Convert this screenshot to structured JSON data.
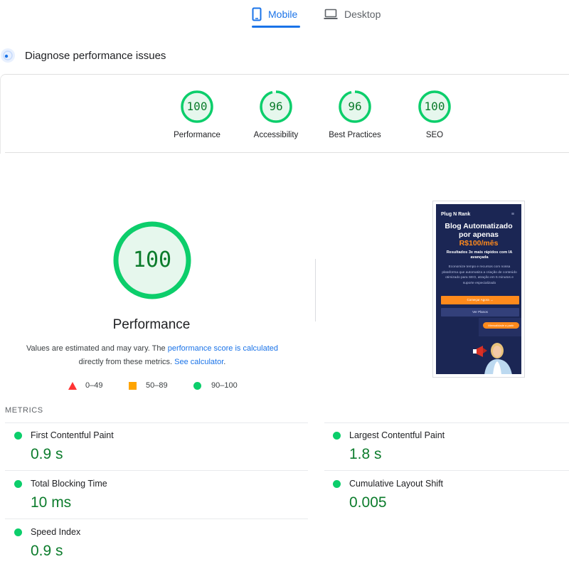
{
  "tabs": {
    "mobile_label": "Mobile",
    "desktop_label": "Desktop",
    "active": "Mobile",
    "accent": "#1a73e8"
  },
  "diagnose": {
    "title": "Diagnose performance issues"
  },
  "scores": [
    {
      "label": "Performance",
      "value": "100",
      "score": 100
    },
    {
      "label": "Accessibility",
      "value": "96",
      "score": 96
    },
    {
      "label": "Best Practices",
      "value": "96",
      "score": 96
    },
    {
      "label": "SEO",
      "value": "100",
      "score": 100
    }
  ],
  "performance": {
    "value": "100",
    "score": 100,
    "title": "Performance",
    "note_prefix": "Values are estimated and may vary. The ",
    "note_link1": "performance score is calculated",
    "note_middle": " directly from these metrics. ",
    "note_link2": "See calculator",
    "note_suffix": "."
  },
  "legend": {
    "poor": "0–49",
    "average": "50–89",
    "good": "90–100",
    "poor_color": "#ff3333",
    "average_color": "#ffa400",
    "good_color": "#0cce6b"
  },
  "thumbnail": {
    "brand": "Plug N Rank",
    "menu_icon": "hamburger-icon",
    "headline_line1": "Blog Automatizado",
    "headline_line2": "por apenas",
    "price": "R$100/mês",
    "subheadline": "Resultados 3x mais rápidos com IA avançada",
    "body": "Economize tempo e recursos com nossa plataforma que automatiza a criação de conteúdo otimizado para SEO, atração em 5 minutos e suporte especializado",
    "cta_primary": "Começar Agora →",
    "cta_secondary": "Ver Planos",
    "tag": "Mensalidade a partir",
    "bg_color": "#1b2654",
    "accent_color": "#ff8a1c"
  },
  "metrics": {
    "heading": "METRICS",
    "items": [
      {
        "label": "First Contentful Paint",
        "value": "0.9 s"
      },
      {
        "label": "Largest Contentful Paint",
        "value": "1.8 s"
      },
      {
        "label": "Total Blocking Time",
        "value": "10 ms"
      },
      {
        "label": "Cumulative Layout Shift",
        "value": "0.005"
      },
      {
        "label": "Speed Index",
        "value": "0.9 s"
      }
    ],
    "good_color": "#0cce6b",
    "value_color": "#0c7c2c"
  }
}
